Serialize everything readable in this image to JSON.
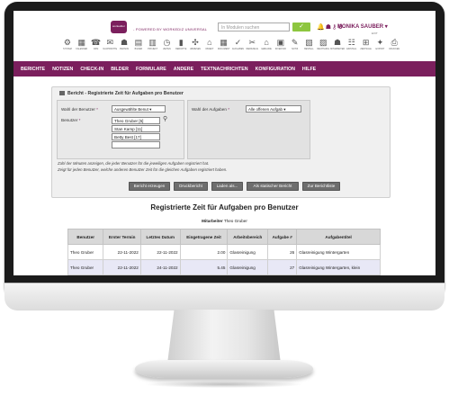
{
  "header": {
    "logo_text": "workeditor",
    "powered_by": "- POWERED BY WORKEDIZ UNIVERSAL",
    "search_placeholder": "In Modulen suchen",
    "search_button": "✓",
    "user_name": "MONIKA SAUBER",
    "exit_label": "EXIT"
  },
  "icon_bar": [
    {
      "glyph": "⚙",
      "label": "SYSTEM"
    },
    {
      "glyph": "▦",
      "label": "KALENDER"
    },
    {
      "glyph": "☎",
      "label": "CRM"
    },
    {
      "glyph": "✉",
      "label": "NACHRICHTEN"
    },
    {
      "glyph": "☗",
      "label": "PERSON"
    },
    {
      "glyph": "▤",
      "label": "BILDER"
    },
    {
      "glyph": "▥",
      "label": "PROJEKT"
    },
    {
      "glyph": "◷",
      "label": "ZEITEN"
    },
    {
      "glyph": "▮",
      "label": "BERICHTE"
    },
    {
      "glyph": "✣",
      "label": "ABWESEN"
    },
    {
      "glyph": "⌂",
      "label": "OBJEKT"
    },
    {
      "glyph": "▦",
      "label": "DOKUMENT"
    },
    {
      "glyph": "✓",
      "label": "AUFGABEN"
    },
    {
      "glyph": "✂",
      "label": "WERKZEUG"
    },
    {
      "glyph": "⌂",
      "label": "GEBÄUDE"
    },
    {
      "glyph": "▣",
      "label": "INVENTAR"
    },
    {
      "glyph": "✎",
      "label": "NOTIZ"
    },
    {
      "glyph": "▧",
      "label": "BESTELL"
    },
    {
      "glyph": "▨",
      "label": "RECHNUNG"
    },
    {
      "glyph": "☗",
      "label": "MITARBEITER"
    },
    {
      "glyph": "☷",
      "label": "EINSTELL"
    },
    {
      "glyph": "⊞",
      "label": "ZENTRALE"
    },
    {
      "glyph": "✦",
      "label": "EXPORT"
    },
    {
      "glyph": "⎙",
      "label": "DRUCKEN"
    }
  ],
  "menu": [
    "BERICHTE",
    "NOTIZEN",
    "CHECK-IN",
    "BILDER",
    "FORMULARE",
    "ANDERE",
    "TEXTNACHRICHTEN",
    "KONFIGURATION",
    "HILFE"
  ],
  "form": {
    "title": "Bericht - Registrierte Zeit für Aufgaben pro Benutzer",
    "user_filter_label": "Wahl der Benutzer",
    "user_filter_value": "Ausgewählte Benut",
    "users_label": "Benutzer",
    "users": [
      "Theo Gruber [5]",
      "Stan Kamp [11]",
      "Betty Best [17]"
    ],
    "task_filter_label": "Wahl der Aufgaben",
    "task_filter_value": "Alle offenen Aufgab",
    "note_line1": "Zahl der Minuten anzeigen, die jeder Benutzer für die jeweiligen Aufgaben registriert hat.",
    "note_line2": "Zeigt für jeden Benutzer, welche anderen Benutzer Zeit für die gleichen Aufgaben registriert haben.",
    "buttons": [
      "Bericht erzeugen",
      "Druckbericht",
      "Laden als...",
      "Als statischer Bericht",
      "Zur Berichtliste"
    ]
  },
  "report": {
    "title": "Registrierte Zeit für Aufgaben pro Benutzer",
    "employee_label": "Mitarbeiter",
    "employee_name": "Theo Gruber",
    "columns": [
      "Benutzer",
      "Erster Termin",
      "Letztes Datum",
      "Eingetragene Zeit",
      "Arbeitsbereich",
      "Aufgabe #",
      "Aufgabentitel"
    ],
    "rows": [
      [
        "Theo Gruber",
        "22-11-2022",
        "22-11-2022",
        "2.00",
        "Glasreinigung",
        "26",
        "Glasreinigung Wintergarten"
      ],
      [
        "Theo Gruber",
        "22-11-2022",
        "24-11-2022",
        "5.45",
        "Glasreinigung",
        "27",
        "Glasreinigung Wintergarten, klein"
      ]
    ]
  },
  "colors": {
    "brand": "#7b1f5d",
    "accent": "#8dc63f"
  }
}
